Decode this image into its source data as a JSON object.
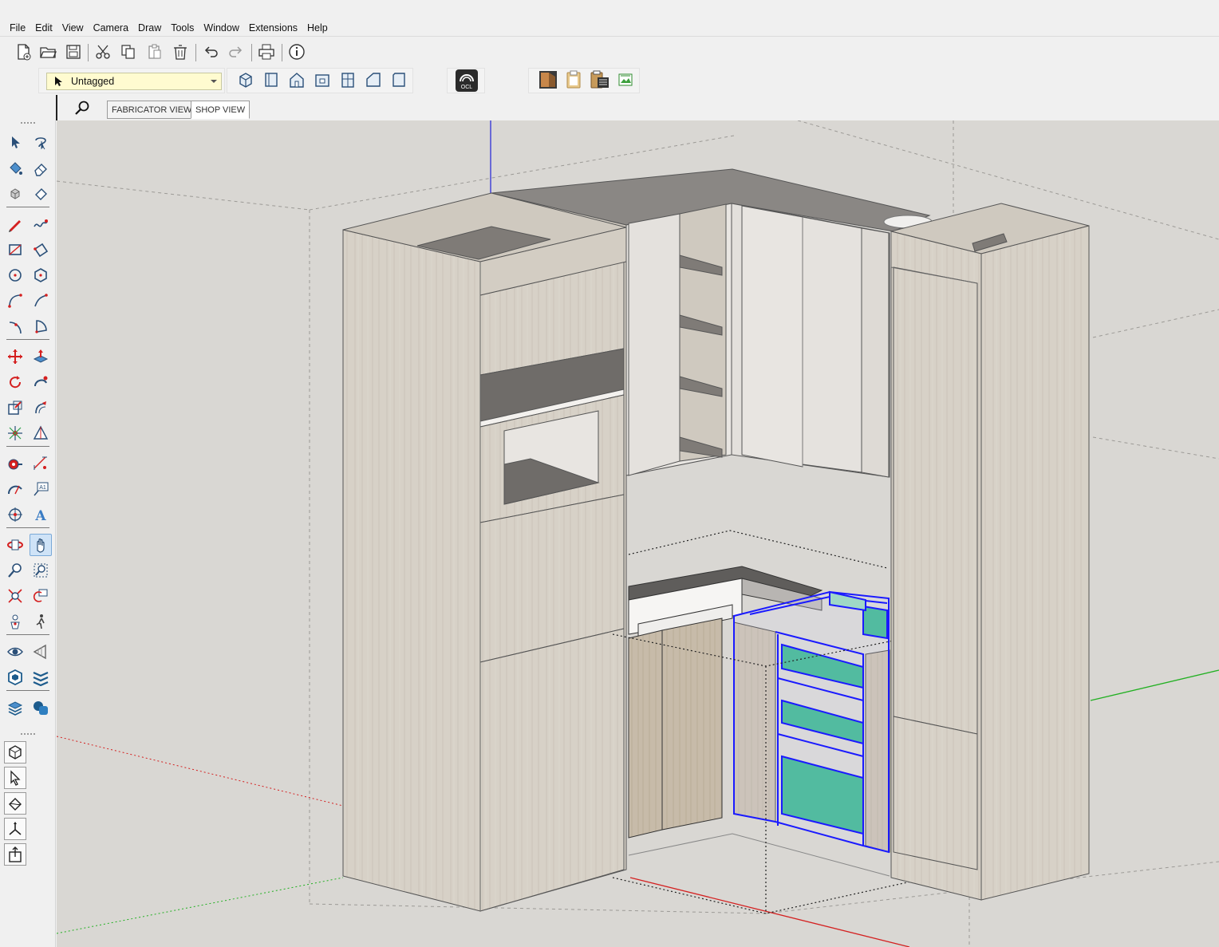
{
  "menu": [
    "File",
    "Edit",
    "View",
    "Camera",
    "Draw",
    "Tools",
    "Window",
    "Extensions",
    "Help"
  ],
  "toolbar_main": [
    {
      "name": "new-file-icon",
      "glyph": "🗋"
    },
    {
      "name": "open-folder-icon",
      "glyph": "📂"
    },
    {
      "name": "save-icon",
      "glyph": "💾"
    },
    {
      "name": "cut-icon",
      "glyph": "✂"
    },
    {
      "name": "copy-icon",
      "glyph": "⧉"
    },
    {
      "name": "paste-icon",
      "glyph": "📋"
    },
    {
      "name": "delete-icon",
      "glyph": "🗑"
    },
    {
      "name": "undo-icon",
      "glyph": "↶"
    },
    {
      "name": "redo-icon",
      "glyph": "↷"
    },
    {
      "name": "print-icon",
      "glyph": "⎙"
    },
    {
      "name": "model-info-icon",
      "glyph": "ⓘ"
    }
  ],
  "tag_selector": {
    "value": "Untagged"
  },
  "views_toolbar": [
    "iso-view-icon",
    "top-view-icon",
    "front-view-icon",
    "right-view-icon",
    "back-view-icon",
    "left-view-icon",
    "bottom-view-icon"
  ],
  "ocl_button": {
    "label": "OCL"
  },
  "extension_tools": [
    "cabinet-tool-icon",
    "clipboard-icon",
    "cutlist-icon",
    "export-sheet-icon"
  ],
  "view_tabs": [
    {
      "label": "FABRICATOR VIEW",
      "active": false
    },
    {
      "label": "SHOP VIEW",
      "active": true
    }
  ],
  "left_tools": [
    "select-icon",
    "lasso-select-icon",
    "paint-bucket-icon",
    "eraser-icon",
    "component-icon",
    "tag-eraser-icon",
    "pencil-line-icon",
    "freehand-icon",
    "rectangle-icon",
    "rotated-rectangle-icon",
    "circle-icon",
    "polygon-icon",
    "arc-icon",
    "two-point-arc-icon",
    "three-point-arc-icon",
    "pie-icon",
    "move-icon",
    "push-pull-icon",
    "rotate-icon",
    "follow-me-icon",
    "scale-icon",
    "offset-icon",
    "solid-tools-icon",
    "section-plane-icon",
    "tape-measure-icon",
    "dimension-icon",
    "protractor-icon",
    "text-label-icon",
    "axes-icon",
    "3d-text-icon",
    "orbit-icon",
    "pan-icon",
    "zoom-icon",
    "zoom-window-icon",
    "zoom-extents-icon",
    "previous-view-icon",
    "position-camera-icon",
    "walk-icon",
    "look-around-icon",
    "section-display-icon",
    "warehouse-icon",
    "extension-warehouse-icon",
    "layout-send-icon",
    "shape-icon"
  ],
  "left_tools_lower": [
    "component-box-icon",
    "select-arrow-icon",
    "materials-icon",
    "axes-tool-icon",
    "export-icon"
  ],
  "colors": {
    "cabinet": "#d6d0c6",
    "cabinet_dark": "#c4bdb2",
    "countertop": "#7a7774",
    "selection": "#1a1aff",
    "drawer_glass": "#52bba0",
    "axis_red": "#d42020",
    "axis_green": "#22b022",
    "axis_blue": "#2020d8",
    "background": "#d9d7d3"
  }
}
